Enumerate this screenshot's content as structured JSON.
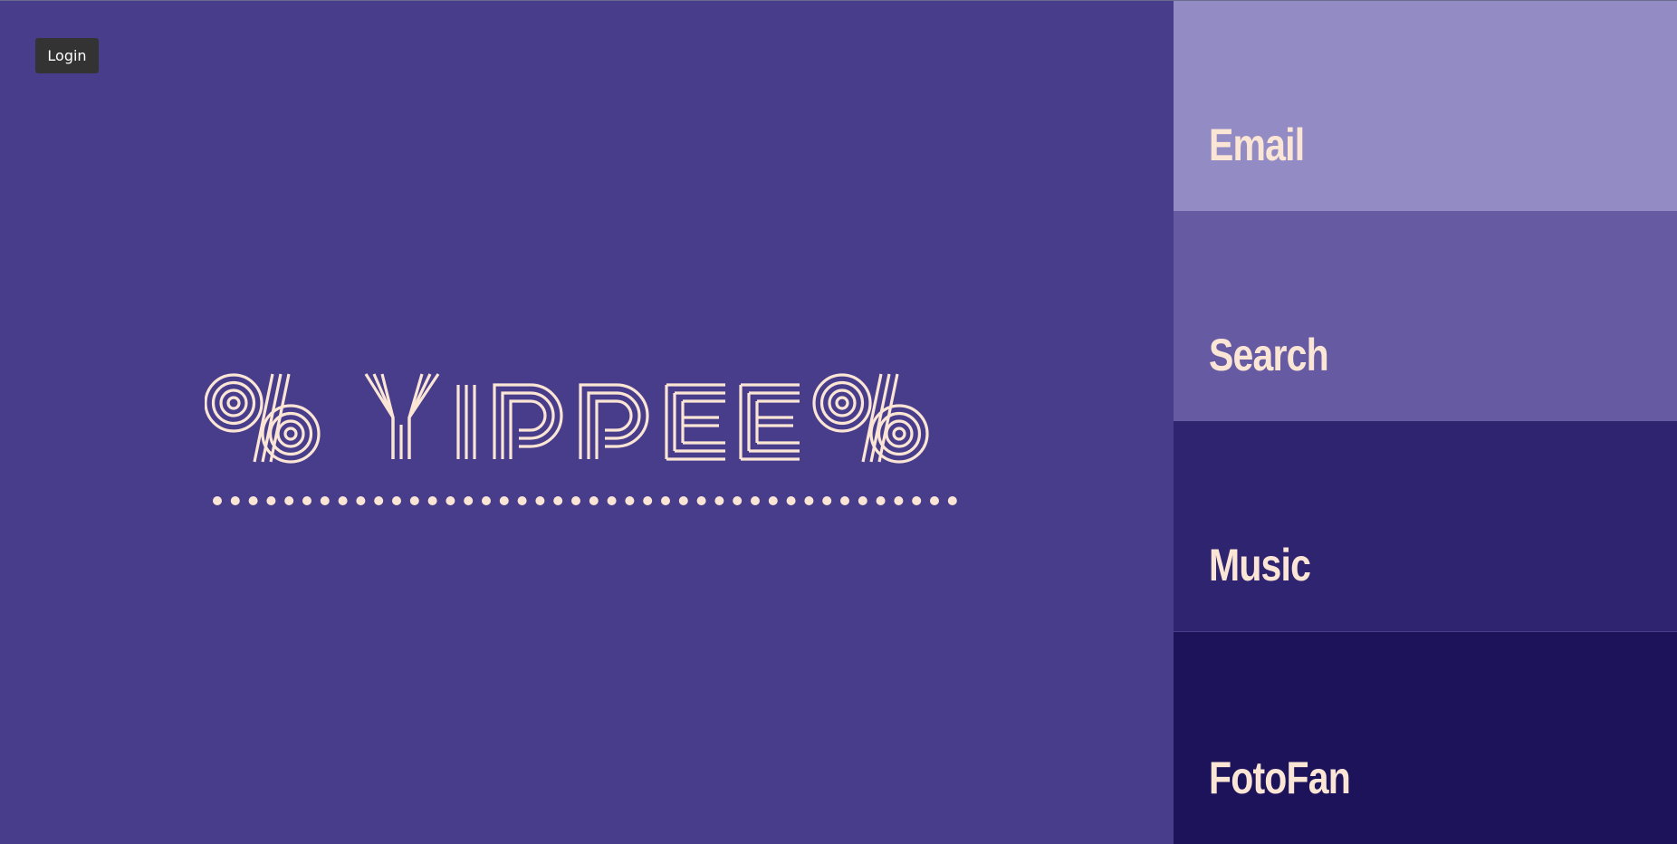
{
  "app": {
    "title": "YIPPEE"
  },
  "login": {
    "label": "Login"
  },
  "logo": {
    "text": "%YIPPEE%",
    "color": "#fbe6d6"
  },
  "colors": {
    "background": "#483d8b",
    "text": "#fbe6d6",
    "login_bg": "#333333"
  },
  "sidebar": {
    "items": [
      {
        "label": "Email",
        "color": "#938bc4"
      },
      {
        "label": "Search",
        "color": "#665ba3"
      },
      {
        "label": "Music",
        "color": "#2f2470"
      },
      {
        "label": "FotoFan",
        "color": "#1c135a"
      }
    ]
  }
}
